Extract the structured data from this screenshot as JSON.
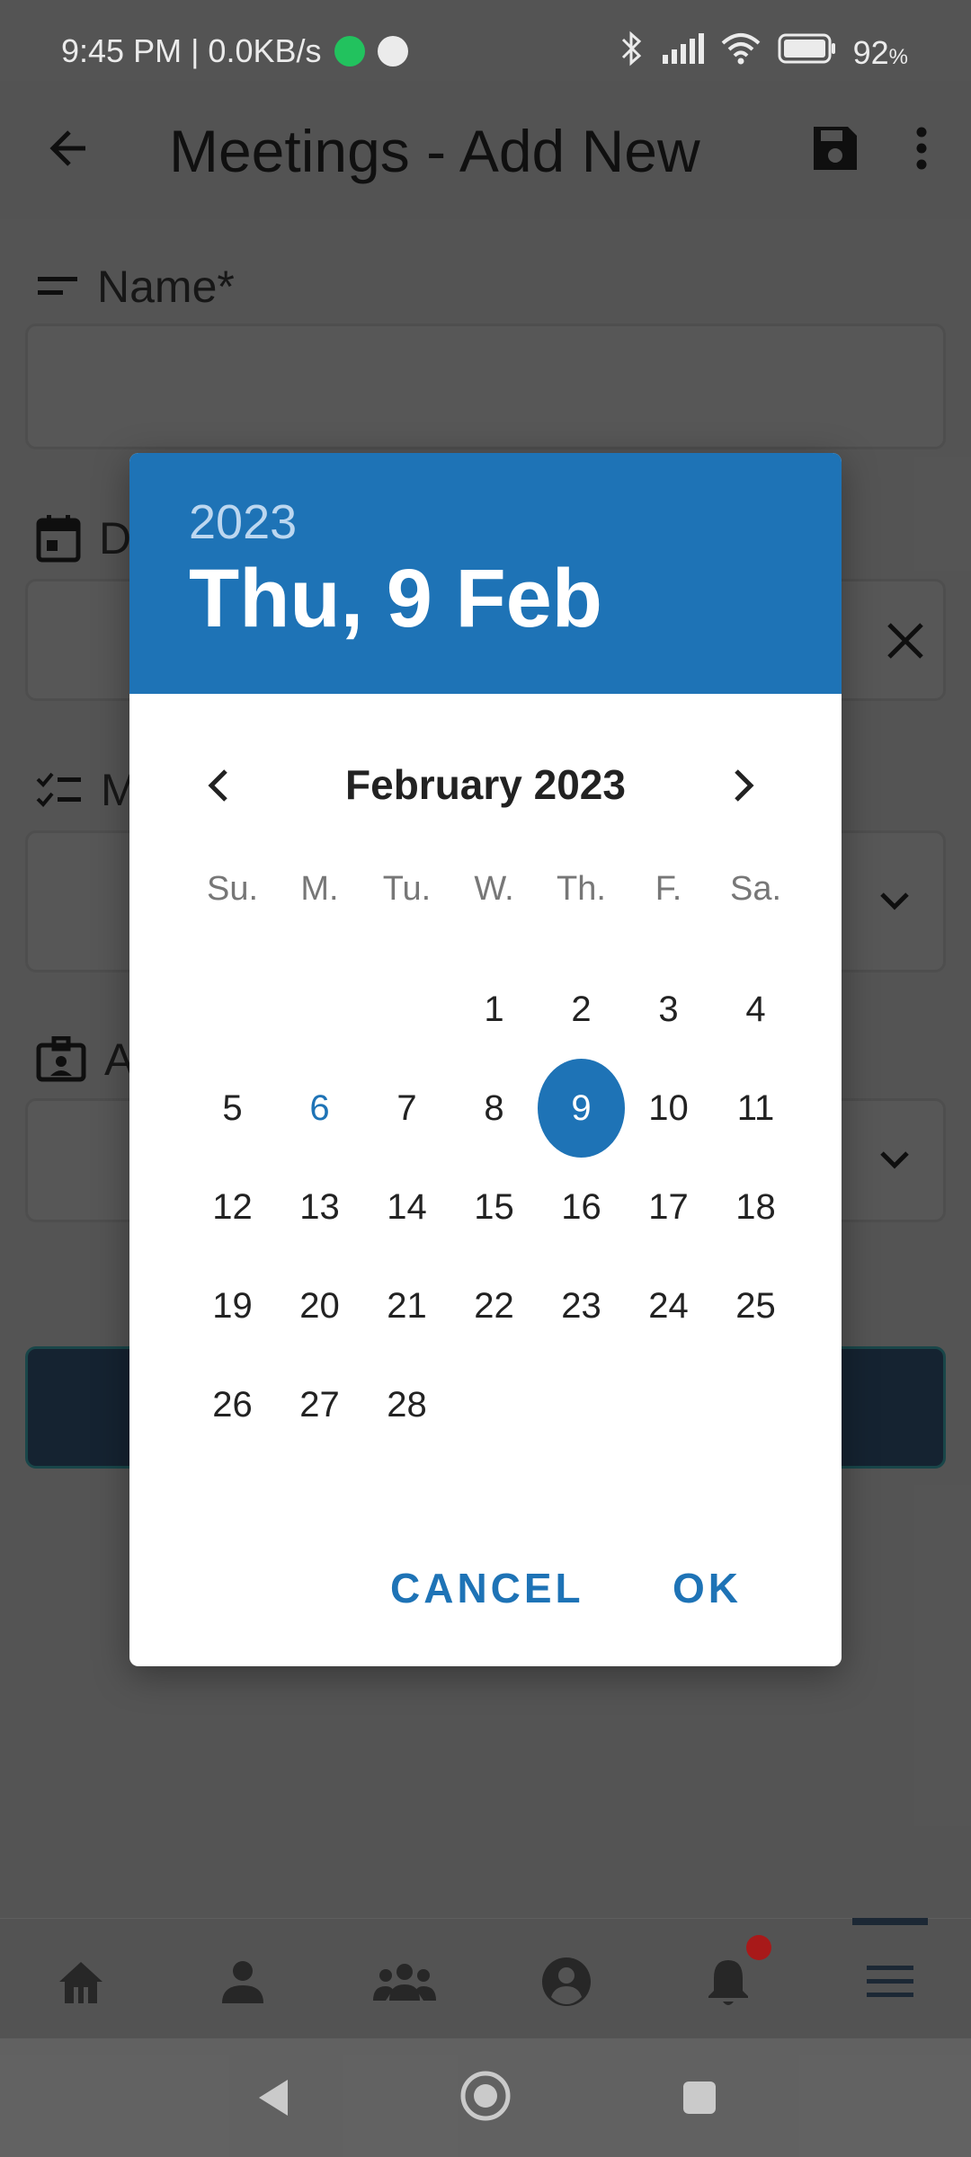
{
  "status_bar": {
    "time_speed": "9:45 PM | 0.0KB/s",
    "battery": "92",
    "battery_unit": "%"
  },
  "app_bar": {
    "title": "Meetings - Add New",
    "back_icon": "arrow-left-icon",
    "save_icon": "floppy-save-icon",
    "menu_icon": "more-vert-icon"
  },
  "form": {
    "name_label": "Name*",
    "date_label_partial": "D",
    "meeting_label_partial": "M",
    "assign_label_partial": "A"
  },
  "date_picker": {
    "header_year": "2023",
    "header_date": "Thu, 9 Feb",
    "month_label": "February 2023",
    "weekdays": [
      "Su.",
      "M.",
      "Tu.",
      "W.",
      "Th.",
      "F.",
      "Sa."
    ],
    "days": [
      "",
      "",
      "",
      "1",
      "2",
      "3",
      "4",
      "5",
      "6",
      "7",
      "8",
      "9",
      "10",
      "11",
      "12",
      "13",
      "14",
      "15",
      "16",
      "17",
      "18",
      "19",
      "20",
      "21",
      "22",
      "23",
      "24",
      "25",
      "26",
      "27",
      "28",
      "",
      "",
      "",
      ""
    ],
    "today": "6",
    "selected": "9",
    "cancel_label": "CANCEL",
    "ok_label": "OK"
  },
  "bottom_nav": {
    "items": [
      "home-icon",
      "person-icon",
      "group-icon",
      "account-circle-icon",
      "bell-icon",
      "menu-icon"
    ],
    "active": "menu-icon"
  },
  "colors": {
    "accent": "#1e73b6",
    "notification_dot": "#c62828"
  }
}
